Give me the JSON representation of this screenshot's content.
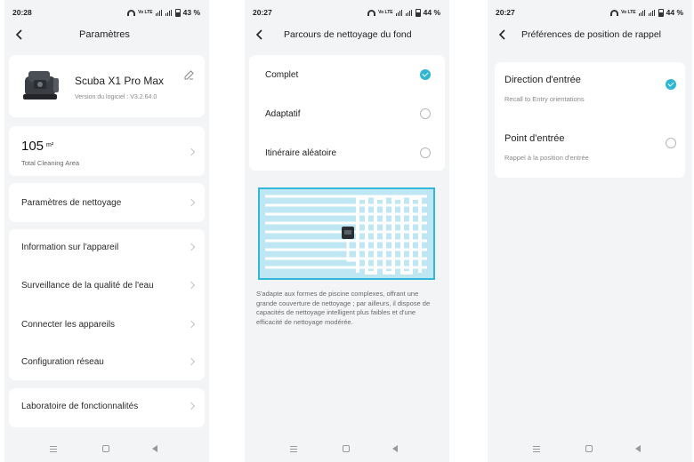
{
  "screens": [
    {
      "status": {
        "time": "20:28",
        "volte": "Vo LTE",
        "battery": "43 %"
      },
      "title": "Paramètres",
      "device": {
        "name": "Scuba X1 Pro Max",
        "version": "Version du logiciel : V3.2.64.0"
      },
      "area": {
        "value": "105",
        "unit": "m²",
        "label": "Total Cleaning Area"
      },
      "menu": [
        "Paramètres de nettoyage",
        "Information sur l'appareil",
        "Surveillance de la qualité de l'eau",
        "Connecter les appareils",
        "Configuration réseau",
        "Laboratoire de fonctionnalités"
      ]
    },
    {
      "status": {
        "time": "20:27",
        "volte": "Vo LTE",
        "battery": "44 %"
      },
      "title": "Parcours de nettoyage du fond",
      "options": [
        {
          "label": "Complet",
          "selected": true
        },
        {
          "label": "Adaptatif",
          "selected": false
        },
        {
          "label": "Itinéraire aléatoire",
          "selected": false
        }
      ],
      "description": "S'adapte aux formes de piscine complexes, offrant une grande couverture de nettoyage ; par ailleurs, il dispose de capacités de nettoyage intelligent plus faibles et d'une efficacité de nettoyage modérée."
    },
    {
      "status": {
        "time": "20:27",
        "volte": "Vo LTE",
        "battery": "44 %"
      },
      "title": "Préférences de position de rappel",
      "options": [
        {
          "label": "Direction d'entrée",
          "sublabel": "Recall to Entry orientations",
          "selected": true
        },
        {
          "label": "Point d'entrée",
          "sublabel": "Rappel à la position d'entrée",
          "selected": false
        }
      ]
    }
  ],
  "colors": {
    "accent": "#2fb6d3",
    "background": "#f3f4f6",
    "card": "#ffffff",
    "pool": "#bfe6f3",
    "pool_border": "#33b7d8"
  },
  "icons": [
    "back-arrow-icon",
    "edit-icon",
    "chevron-right-icon",
    "check-icon",
    "wifi-icon",
    "signal-icon",
    "battery-icon",
    "nav-menu-icon",
    "nav-home-icon",
    "nav-back-icon"
  ]
}
